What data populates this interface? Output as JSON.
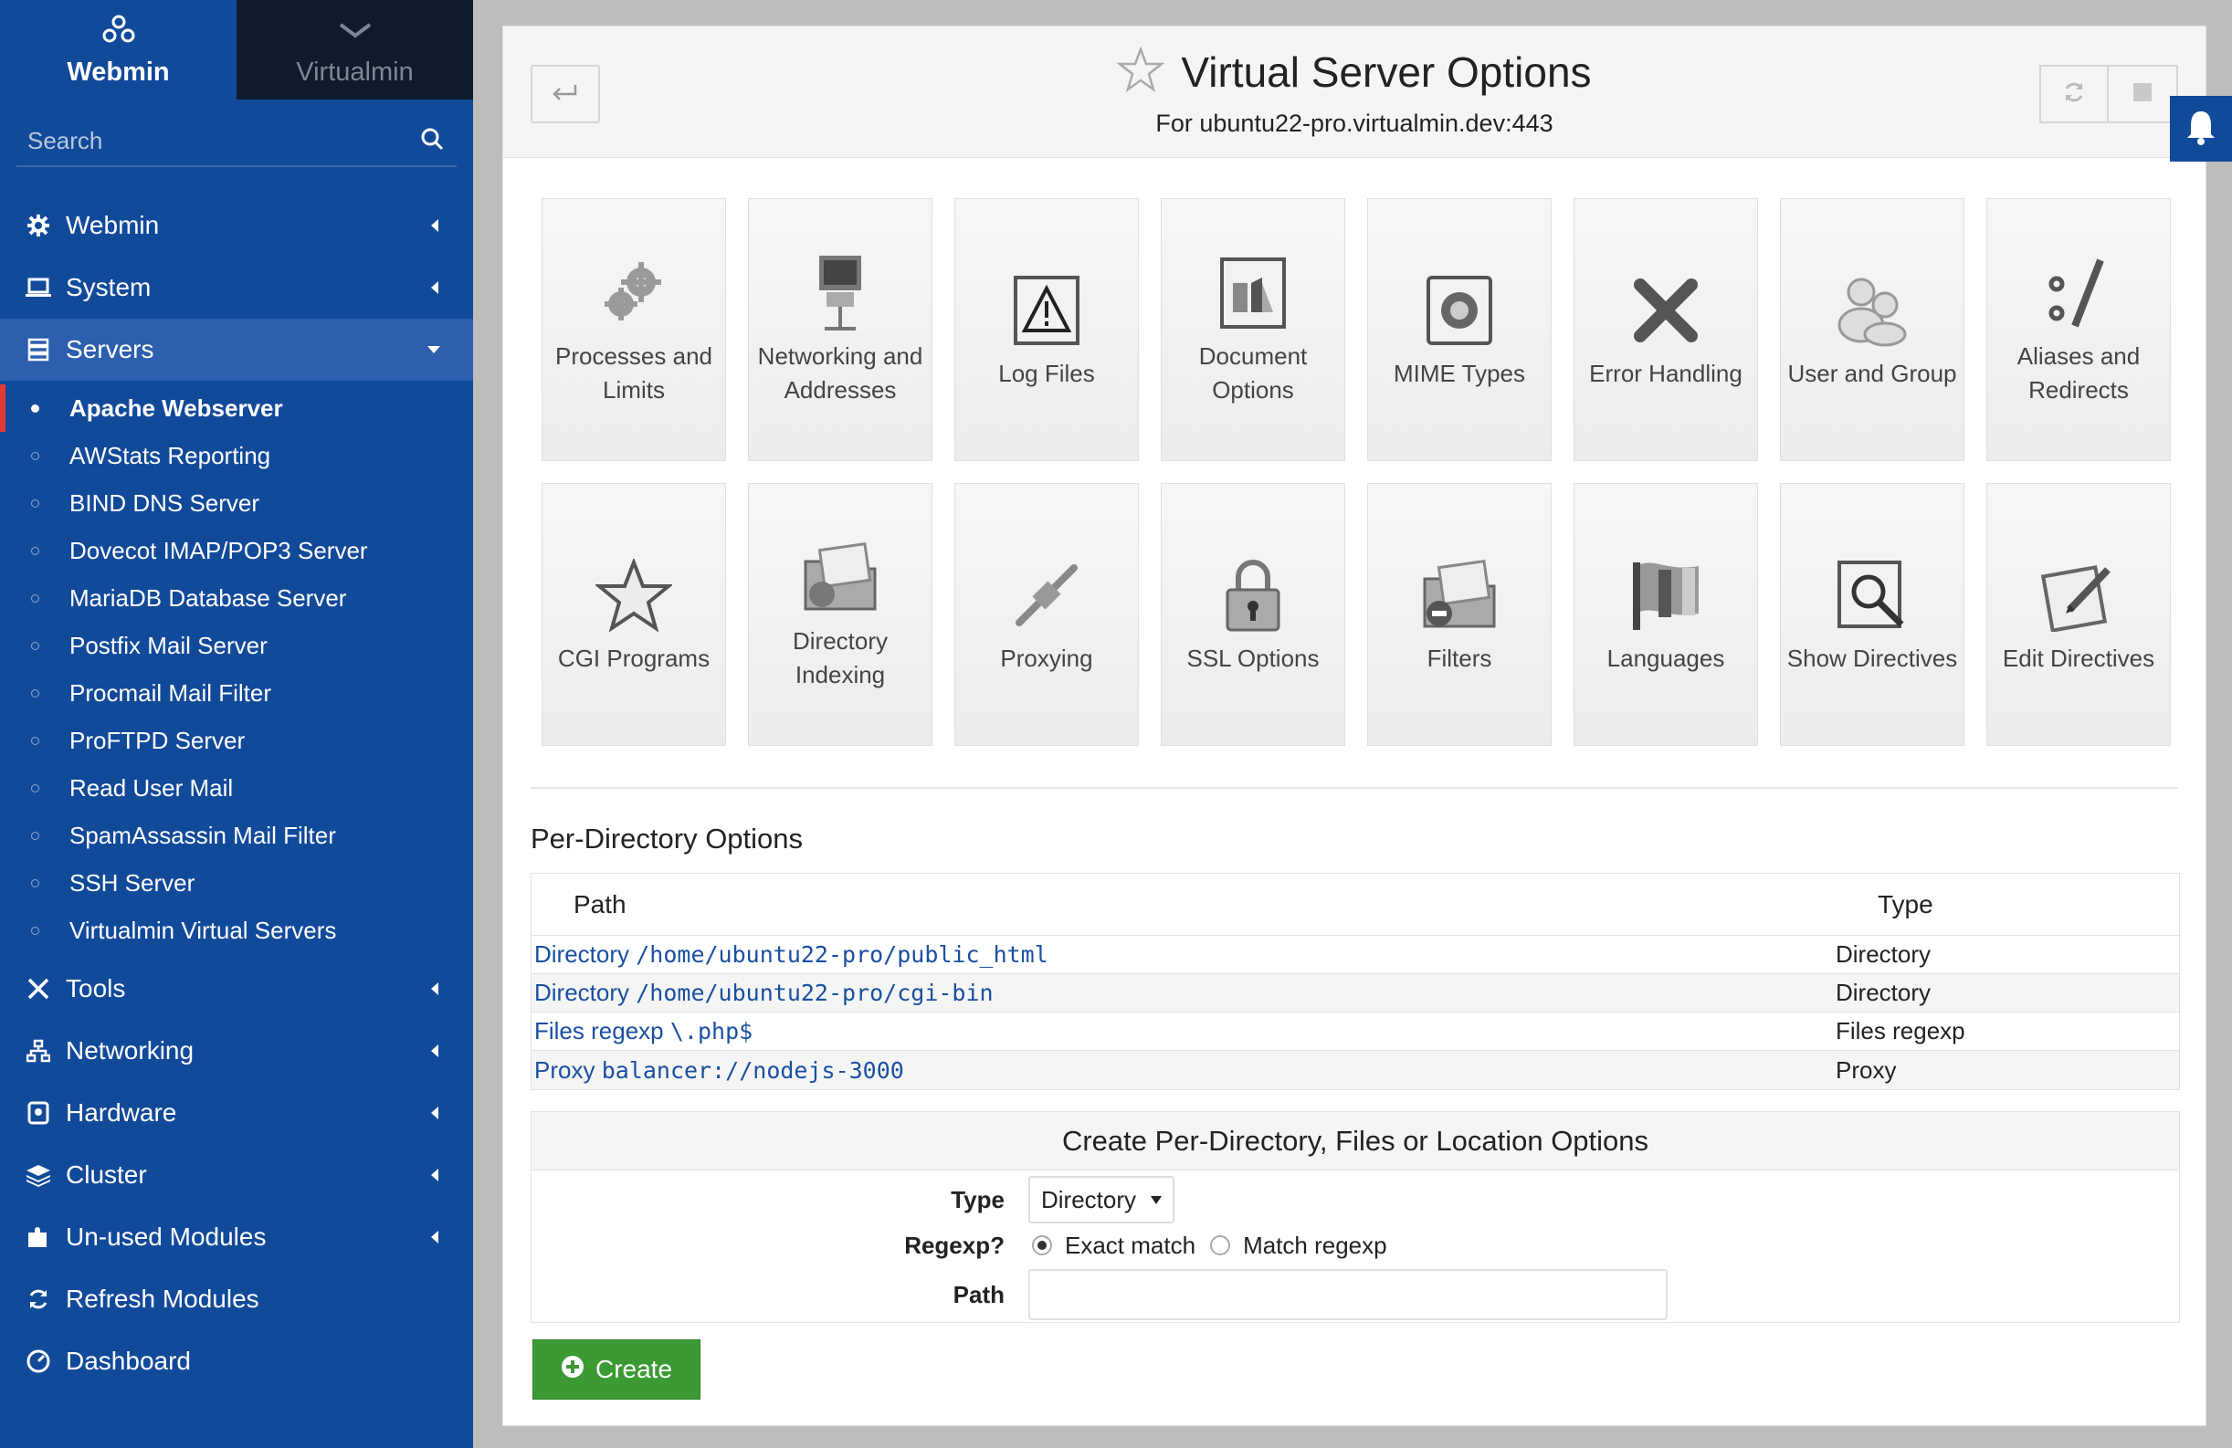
{
  "sidebar": {
    "tabs": [
      {
        "label": "Webmin",
        "icon": "webmin-logo-icon"
      },
      {
        "label": "Virtualmin",
        "icon": "chevron-down-icon"
      }
    ],
    "search": {
      "placeholder": "Search",
      "icon": "search-icon"
    },
    "menu": [
      {
        "label": "Webmin",
        "icon": "gear-icon"
      },
      {
        "label": "System",
        "icon": "laptop-icon"
      },
      {
        "label": "Servers",
        "icon": "server-icon",
        "expanded": true
      }
    ],
    "servers_submenu": [
      {
        "label": "Apache Webserver",
        "current": true
      },
      {
        "label": "AWStats Reporting"
      },
      {
        "label": "BIND DNS Server"
      },
      {
        "label": "Dovecot IMAP/POP3 Server"
      },
      {
        "label": "MariaDB Database Server"
      },
      {
        "label": "Postfix Mail Server"
      },
      {
        "label": "Procmail Mail Filter"
      },
      {
        "label": "ProFTPD Server"
      },
      {
        "label": "Read User Mail"
      },
      {
        "label": "SpamAssassin Mail Filter"
      },
      {
        "label": "SSH Server"
      },
      {
        "label": "Virtualmin Virtual Servers"
      }
    ],
    "menu_lower": [
      {
        "label": "Tools",
        "icon": "tools-icon"
      },
      {
        "label": "Networking",
        "icon": "network-icon"
      },
      {
        "label": "Hardware",
        "icon": "hardware-icon"
      },
      {
        "label": "Cluster",
        "icon": "layers-icon"
      },
      {
        "label": "Un-used Modules",
        "icon": "puzzle-icon"
      },
      {
        "label": "Refresh Modules",
        "icon": "refresh-icon"
      },
      {
        "label": "Dashboard",
        "icon": "dashboard-icon"
      }
    ]
  },
  "header": {
    "title": "Virtual Server Options",
    "subtitle": "For ubuntu22-pro.virtualmin.dev:443"
  },
  "tiles": [
    {
      "label": "Processes and Limits",
      "icon": "gears-icon"
    },
    {
      "label": "Networking and Addresses",
      "icon": "network-computer-icon"
    },
    {
      "label": "Log Files",
      "icon": "warning-icon"
    },
    {
      "label": "Document Options",
      "icon": "document-options-icon"
    },
    {
      "label": "MIME Types",
      "icon": "mime-types-icon"
    },
    {
      "label": "Error Handling",
      "icon": "x-icon"
    },
    {
      "label": "User and Group",
      "icon": "users-icon"
    },
    {
      "label": "Aliases and Redirects",
      "icon": "alias-icon"
    },
    {
      "label": "CGI Programs",
      "icon": "star-icon"
    },
    {
      "label": "Directory Indexing",
      "icon": "folder-icon"
    },
    {
      "label": "Proxying",
      "icon": "proxy-icon"
    },
    {
      "label": "SSL Options",
      "icon": "lock-icon"
    },
    {
      "label": "Filters",
      "icon": "filter-folder-icon"
    },
    {
      "label": "Languages",
      "icon": "flag-icon"
    },
    {
      "label": "Show Directives",
      "icon": "magnifier-icon"
    },
    {
      "label": "Edit Directives",
      "icon": "edit-icon"
    }
  ],
  "per_directory": {
    "title": "Per-Directory Options",
    "columns": [
      "Path",
      "Type"
    ],
    "rows": [
      {
        "prefix": "Directory",
        "path": "/home/ubuntu22-pro/public_html",
        "type": "Directory"
      },
      {
        "prefix": "Directory",
        "path": "/home/ubuntu22-pro/cgi-bin",
        "type": "Directory"
      },
      {
        "prefix": "Files regexp",
        "path": "\\.php$",
        "type": "Files regexp"
      },
      {
        "prefix": "Proxy",
        "path": "balancer://nodejs-3000",
        "type": "Proxy"
      }
    ]
  },
  "create_form": {
    "title": "Create Per-Directory, Files or Location Options",
    "type_label": "Type",
    "type_value": "Directory",
    "regexp_label": "Regexp?",
    "regexp_options": [
      "Exact match",
      "Match regexp"
    ],
    "regexp_selected": "Exact match",
    "path_label": "Path",
    "path_value": "",
    "create_button": "Create"
  }
}
